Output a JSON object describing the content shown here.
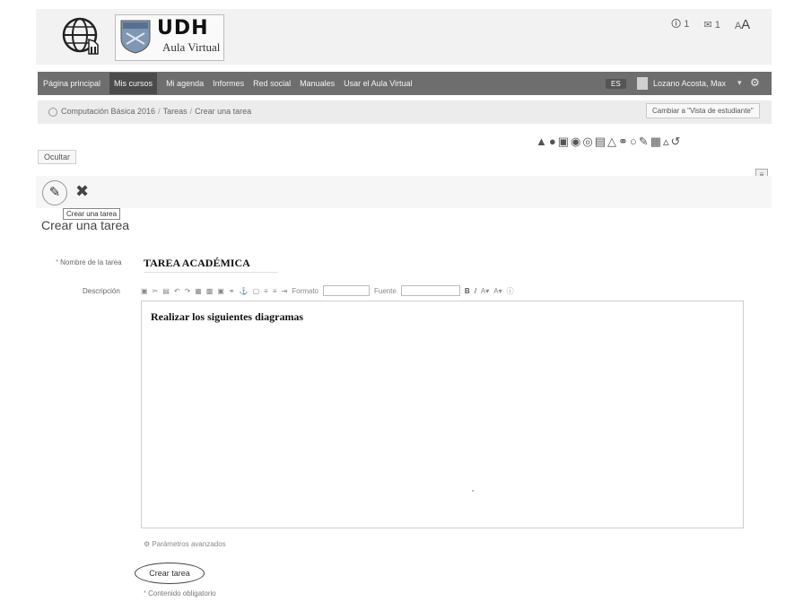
{
  "header": {
    "logo_udh": "UDH",
    "logo_subtitle": "Aula Virtual",
    "top_right": {
      "notifications": "1",
      "messages": "1",
      "font_small": "A",
      "font_large": "A"
    }
  },
  "nav": {
    "items": [
      "Página principal",
      "Mis cursos",
      "Mi agenda",
      "Informes",
      "Red social",
      "Manuales",
      "Usar el Aula Virtual"
    ],
    "active_index": 1,
    "language": "ES",
    "user_name": "Lozano Acosta, Max"
  },
  "breadcrumb": {
    "items": [
      "Computación Básica 2016",
      "Tareas",
      "Crear una tarea"
    ],
    "student_view_button": "Cambiar a \"Vista de estudiante\""
  },
  "page": {
    "hide_button": "Ocultar",
    "tooltip": "Crear una tarea",
    "title": "Crear una tarea"
  },
  "form": {
    "name_label": "Nombre de la tarea",
    "name_value": "TAREA ACADÉMICA",
    "description_label": "Descripción",
    "toolbar": {
      "format_label": "Formato",
      "font_label": "Fuente"
    },
    "description_text": "Realizar los siguientes diagramas",
    "params_link": "Parámetros avanzados",
    "submit_button": "Crear tarea",
    "required_note": "Contenido obligatorio"
  },
  "colors": {
    "nav_bg": "#6e6e6e",
    "nav_active": "#4b4b4b",
    "crumb_bg": "#ececec"
  }
}
